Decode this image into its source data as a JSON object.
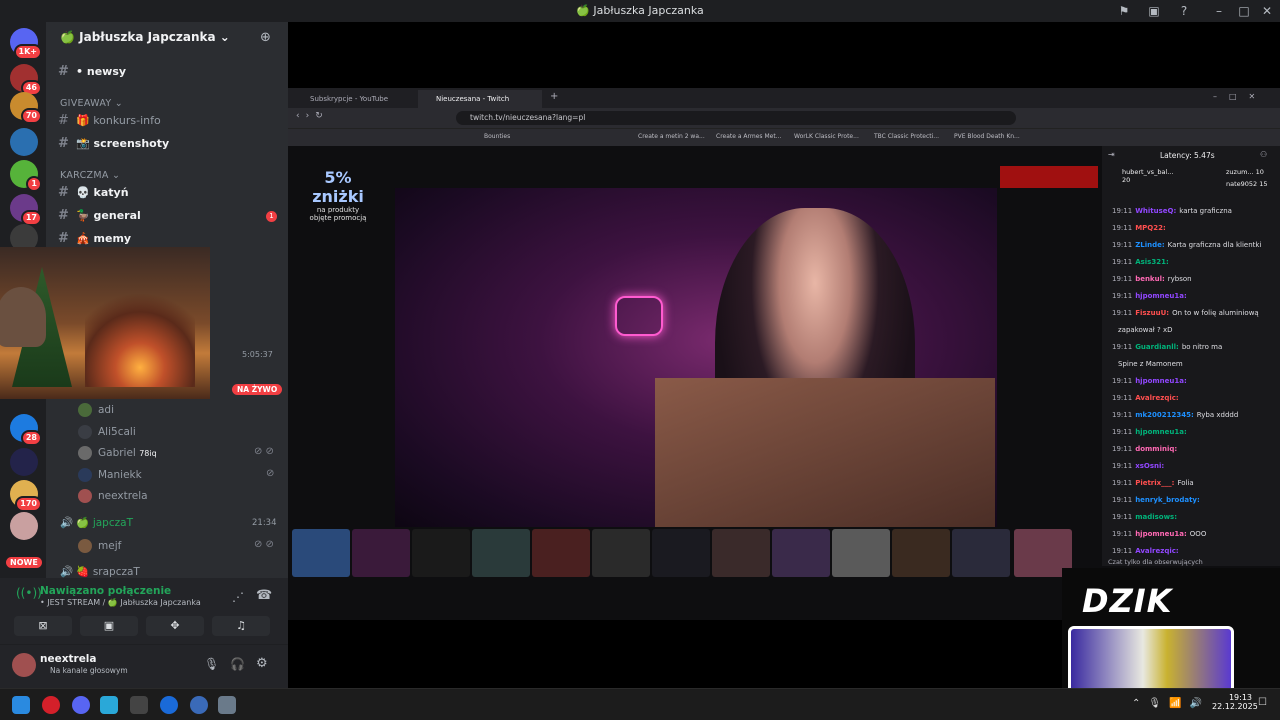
{
  "window": {
    "title": "🍏 Jabłuszka Japczanka"
  },
  "rail": {
    "badges": [
      "1K+",
      "46",
      "70",
      "1",
      "17",
      "28",
      "170",
      "NOWE"
    ]
  },
  "server": {
    "name": "Jabłuszka Japczanka",
    "channels_top": [
      {
        "label": "• newsy"
      }
    ],
    "category_giveaway": "GIVEAWAY",
    "channels_giveaway": [
      {
        "label": "konkurs-info"
      },
      {
        "label": "screenshoty"
      }
    ],
    "category_karczma": "KARCZMA",
    "channels_karczma": [
      {
        "label": "katyń"
      },
      {
        "label": "general",
        "badge": "1"
      },
      {
        "label": "memy"
      }
    ],
    "stream_timer": "5:05:37",
    "live_badge": "NA ŻYWO",
    "voice_users": [
      {
        "name": "adi"
      },
      {
        "name": "Ali5cali"
      },
      {
        "name": "Gabriel",
        "tag": "78iq"
      },
      {
        "name": "Maniekk"
      },
      {
        "name": "neextrela"
      }
    ],
    "voice_channel_2": {
      "name": "japczaT",
      "time": "21:34"
    },
    "voice_users_2": [
      {
        "name": "mejf"
      }
    ],
    "voice_channel_3": {
      "name": "srapczaT"
    }
  },
  "voice_panel": {
    "status": "Nawiązano połączenie",
    "detail": "• JEST STREAM / 🍏 Jabłuszka Japczanka"
  },
  "user_panel": {
    "name": "neextrela",
    "status": "Na kanale głosowym"
  },
  "browser": {
    "tabs": [
      {
        "label": "Subskrypcje - YouTube"
      },
      {
        "label": "Nieuczesana - Twitch"
      }
    ],
    "url": "twitch.tv/nieuczesana?lang=pl",
    "bookmarks": [
      "Bounties",
      "Create a metin 2 wa...",
      "Create a Armes Met...",
      "WorLK Classic Prote...",
      "TBC Classic Protecti...",
      "PVE Blood Death Kn..."
    ],
    "promo": {
      "big": "5% zniżki",
      "small1": "na produkty",
      "small2": "objęte promocją"
    },
    "chat": {
      "latency": "Latency: 5.47s",
      "gift_user1": "hubert_vs_bal...",
      "gift_count1": "20",
      "gift_user2": "zuzum...",
      "gift_count2": "10",
      "gift_user3": "nate9052",
      "gift_count3": "15",
      "messages": [
        {
          "time": "19:11",
          "user": "WhituseQ:",
          "text": "karta graficzna"
        },
        {
          "time": "19:11",
          "user": "MPQ22:",
          "text": ""
        },
        {
          "time": "19:11",
          "user": "ZLinde:",
          "text": "Karta graficzna dla klientki"
        },
        {
          "time": "19:11",
          "user": "Asis321:",
          "text": ""
        },
        {
          "time": "19:11",
          "user": "benkul:",
          "text": "rybson"
        },
        {
          "time": "19:11",
          "user": "hjpomneu1a:",
          "text": ""
        },
        {
          "time": "19:11",
          "user": "FiszuuU:",
          "text": "On to w folię aluminiową"
        },
        {
          "time": "",
          "user": "",
          "text": "zapakował ? xD"
        },
        {
          "time": "19:11",
          "user": "Guardianll:",
          "text": "bo nitro ma"
        },
        {
          "time": "",
          "user": "",
          "text": "Spine z Mamonem"
        },
        {
          "time": "19:11",
          "user": "hjpomneu1a:",
          "text": ""
        },
        {
          "time": "19:11",
          "user": "Avalrezqic:",
          "text": ""
        },
        {
          "time": "19:11",
          "user": "mk200212345:",
          "text": "Ryba xdddd"
        },
        {
          "time": "19:11",
          "user": "hjpomneu1a:",
          "text": ""
        },
        {
          "time": "19:11",
          "user": "domminiq:",
          "text": ""
        },
        {
          "time": "19:11",
          "user": "xsOsni:",
          "text": ""
        },
        {
          "time": "19:11",
          "user": "Pietrix___:",
          "text": "Folia"
        },
        {
          "time": "19:11",
          "user": "henryk_brodaty:",
          "text": ""
        },
        {
          "time": "19:11",
          "user": "madisows:",
          "text": ""
        },
        {
          "time": "19:11",
          "user": "hjpomneu1a:",
          "text": "OOO"
        },
        {
          "time": "19:11",
          "user": "Avalrezqic:",
          "text": ""
        }
      ],
      "input_placeholder": "Czat tylko dla obserwujących"
    }
  },
  "overlay": {
    "logo": "DZIK"
  },
  "taskbar": {
    "time": "19:13",
    "date": "22.12.2025"
  }
}
